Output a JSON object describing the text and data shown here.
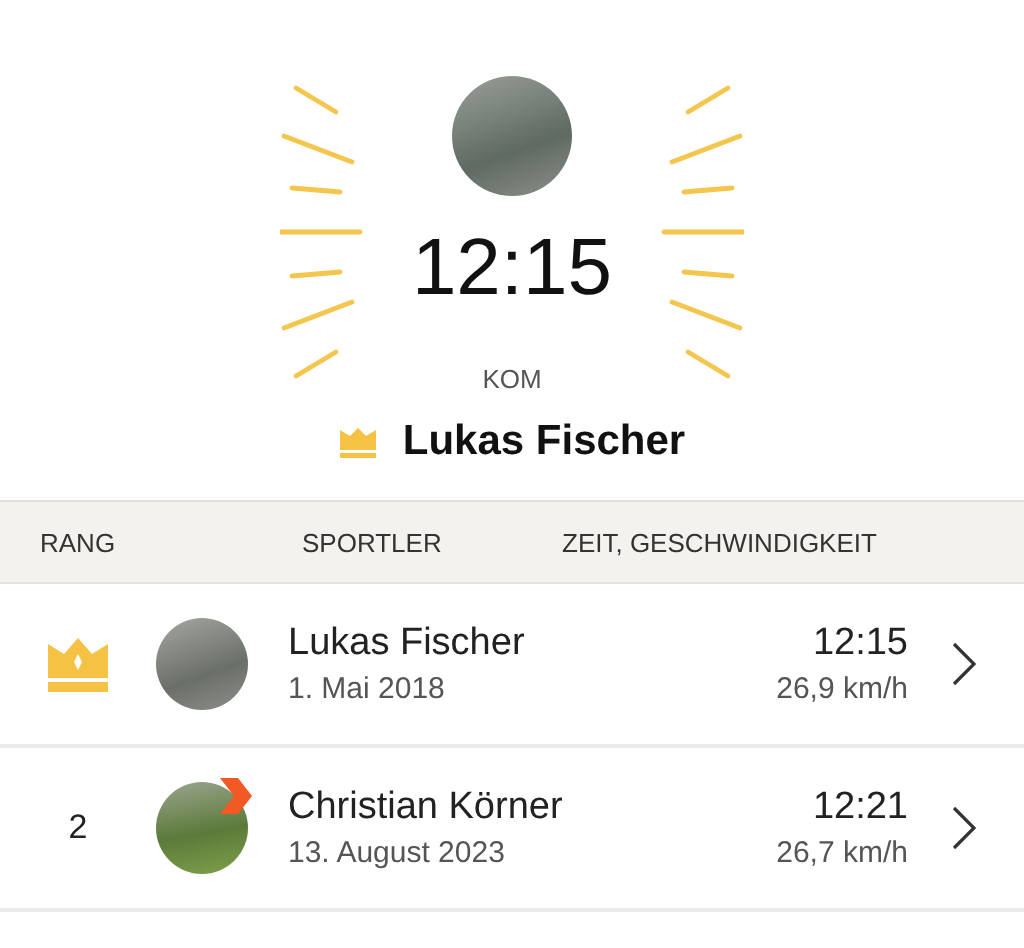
{
  "hero": {
    "time": "12:15",
    "label": "KOM",
    "holder": "Lukas Fischer"
  },
  "table": {
    "columns": [
      "RANG",
      "SPORTLER",
      "ZEIT, GESCHWINDIGKEIT"
    ],
    "rows": [
      {
        "kind": "crown",
        "name": "Lukas Fischer",
        "date": "1. Mai 2018",
        "time": "12:15",
        "speed": "26,9 km/h",
        "badge": false
      },
      {
        "kind": "number",
        "rank": "2",
        "name": "Christian Körner",
        "date": "13. August 2023",
        "time": "12:21",
        "speed": "26,7 km/h",
        "badge": true
      }
    ]
  }
}
